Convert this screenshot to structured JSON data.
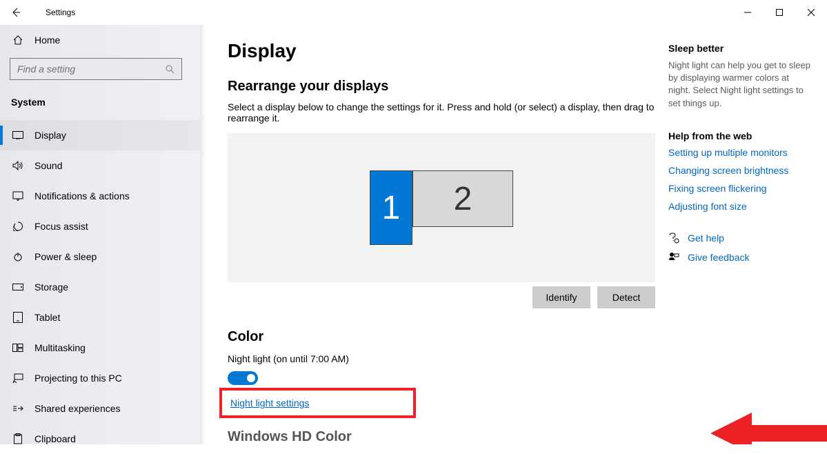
{
  "window": {
    "title": "Settings"
  },
  "sidebar": {
    "home": "Home",
    "search_placeholder": "Find a setting",
    "section": "System",
    "items": [
      {
        "label": "Display"
      },
      {
        "label": "Sound"
      },
      {
        "label": "Notifications & actions"
      },
      {
        "label": "Focus assist"
      },
      {
        "label": "Power & sleep"
      },
      {
        "label": "Storage"
      },
      {
        "label": "Tablet"
      },
      {
        "label": "Multitasking"
      },
      {
        "label": "Projecting to this PC"
      },
      {
        "label": "Shared experiences"
      },
      {
        "label": "Clipboard"
      }
    ]
  },
  "page": {
    "title": "Display",
    "rearrange_heading": "Rearrange your displays",
    "rearrange_desc": "Select a display below to change the settings for it. Press and hold (or select) a display, then drag to rearrange it.",
    "monitor1": "1",
    "monitor2": "2",
    "identify": "Identify",
    "detect": "Detect",
    "color_heading": "Color",
    "night_status": "Night light (on until 7:00 AM)",
    "toggle_label": "On",
    "night_settings": "Night light settings",
    "hd_color": "Windows HD Color"
  },
  "aside": {
    "sleep_title": "Sleep better",
    "sleep_text": "Night light can help you get to sleep by displaying warmer colors at night. Select Night light settings to set things up.",
    "help_title": "Help from the web",
    "links": [
      "Setting up multiple monitors",
      "Changing screen brightness",
      "Fixing screen flickering",
      "Adjusting font size"
    ],
    "get_help": "Get help",
    "feedback": "Give feedback"
  }
}
